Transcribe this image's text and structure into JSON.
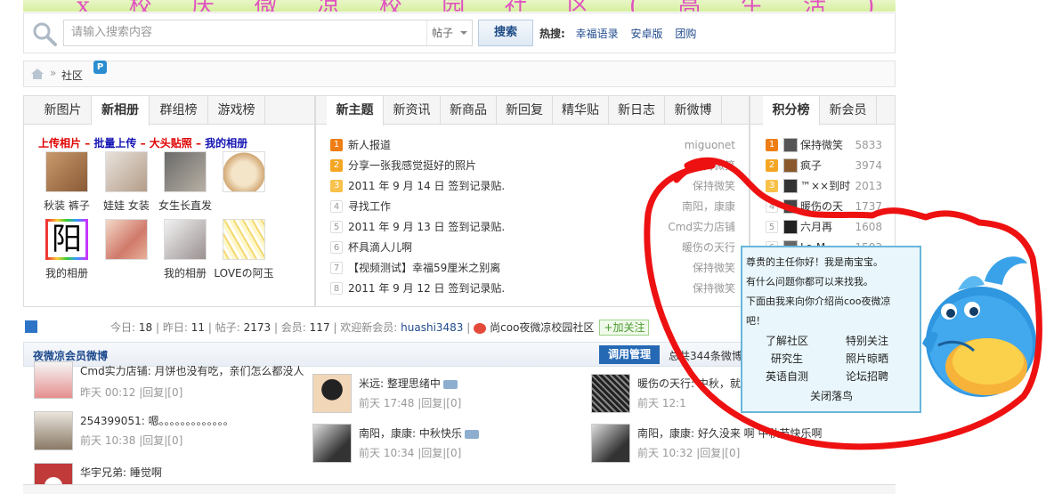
{
  "banner": {
    "text": "ⅹ 校 庆 微 凉 校 园 社 区 ( 高 生 活 )"
  },
  "search": {
    "placeholder": "请输入搜索内容",
    "scope": "帖子",
    "button": "搜索",
    "hot_label": "热搜:",
    "hot_links": [
      "幸福语录",
      "安卓版",
      "团购"
    ]
  },
  "breadcrumb": {
    "sep": "»",
    "current": "社区"
  },
  "left_panel": {
    "tabs": [
      "新图片",
      "新相册",
      "群组榜",
      "游戏榜"
    ],
    "active_tab": 1,
    "upload_links": [
      "上传相片",
      "批量上传",
      "大头贴照",
      "我的相册"
    ],
    "albums": [
      "秋装 裤子",
      "娃娃 女装",
      "女生长直发",
      "",
      "我的相册",
      "",
      "我的相册",
      "LOVEの阿玉"
    ]
  },
  "mid_panel": {
    "tabs": [
      "新主题",
      "新资讯",
      "新商品",
      "新回复",
      "精华贴",
      "新日志",
      "新微博"
    ],
    "active_tab": 0,
    "topics": [
      {
        "rank": "1",
        "title": "新人报道",
        "author": "miguonet"
      },
      {
        "rank": "2",
        "title": "分享一张我感觉挺好的照片",
        "author": "保持微笑"
      },
      {
        "rank": "3",
        "title": "2011 年 9 月 14 日 签到记录贴.",
        "author": "保持微笑"
      },
      {
        "rank": "4",
        "title": "寻找工作",
        "author": "南阳，康康"
      },
      {
        "rank": "5",
        "title": "2011 年 9 月 13 日 签到记录贴.",
        "author": "Cmd实力店铺"
      },
      {
        "rank": "6",
        "title": "杯具滴人儿啊",
        "author": "暖伤の天行"
      },
      {
        "rank": "7",
        "title": "【视频测试】幸福59厘米之别离",
        "author": "保持微笑"
      },
      {
        "rank": "8",
        "title": "2011 年 9 月 12 日 签到记录贴.",
        "author": "保持微笑"
      }
    ]
  },
  "right_panel": {
    "tabs": [
      "积分榜",
      "新会员"
    ],
    "active_tab": 0,
    "scores": [
      {
        "rank": "1",
        "name": "保持微笑",
        "score": "5833"
      },
      {
        "rank": "2",
        "name": "疯子",
        "score": "3974"
      },
      {
        "rank": "3",
        "name": "™××到时",
        "score": "2013"
      },
      {
        "rank": "4",
        "name": "暖伤の天",
        "score": "1737"
      },
      {
        "rank": "5",
        "name": "六月再",
        "score": "1608"
      },
      {
        "rank": "6",
        "name": "La M",
        "score": "1503"
      }
    ]
  },
  "stats": {
    "today_label": "今日:",
    "today": "18",
    "yesterday_label": "昨日:",
    "yesterday": "11",
    "posts_label": "帖子:",
    "posts": "2173",
    "members_label": "会员:",
    "members": "117",
    "welcome": "欢迎新会员:",
    "new_member": "huashi3483",
    "weibo_name": "尚coo夜微凉校园社区",
    "follow": "+加关注"
  },
  "weibo": {
    "title": "夜微凉会员微博",
    "manage": "调用管理",
    "total": "总共344条微博",
    "items": [
      {
        "text": "Cmd实力店铺: 月饼也没有吃，亲们怎么都没人",
        "meta": "昨天 00:12 |回复|[0]"
      },
      {
        "text": "254399051: 嗯。。。。。。。。。。。。。",
        "meta": "前天 10:38 |回复|[0]"
      },
      {
        "text": "华宇兄弟: 睡觉啊",
        "meta": ""
      },
      {
        "text": "米远: 整理思绪中",
        "meta": "前天 17:48 |回复|[0]"
      },
      {
        "text": "南阳，康康: 中秋快乐",
        "meta": "前天 10:34 |回复|[0]"
      },
      {
        "text": "暖伤の天行: 中秋，就",
        "meta": "前天 12:1"
      },
      {
        "text": "南阳，康康: 好久没来 啊   中秋节快乐啊",
        "meta": "前天 10:32 |回复|[0]"
      }
    ]
  },
  "robot": {
    "lines": [
      "尊贵的主任你好！我是南宝宝。",
      "有什么问题你都可以来找我。",
      "下面由我来向你介绍尚coo夜微凉",
      "吧！"
    ],
    "links": [
      "了解社区",
      "特别关注",
      "研究生",
      "照片晾晒",
      "英语自测",
      "论坛招聘"
    ],
    "close": "关闭落鸟"
  },
  "colors": {
    "accent": "#2569b5",
    "link": "#1f4a8c",
    "annotation": "#ee1111",
    "bubble_border": "#68b6d9"
  }
}
